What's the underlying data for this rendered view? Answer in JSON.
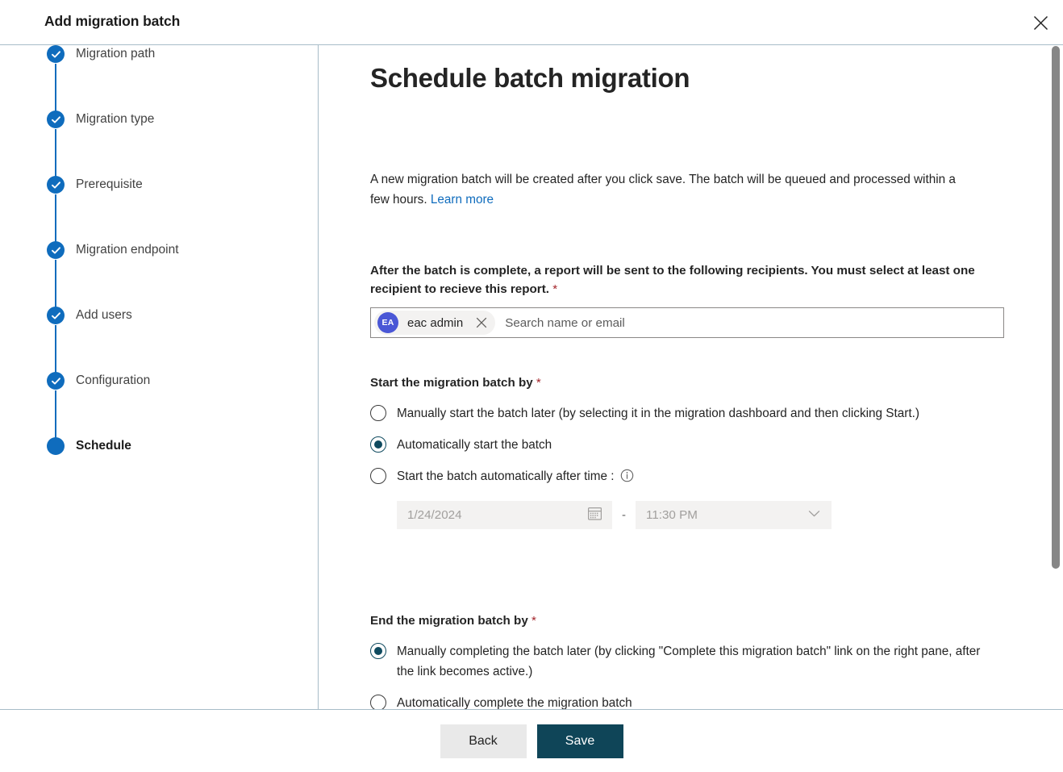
{
  "dialog": {
    "title": "Add migration batch",
    "close_icon": "close-icon"
  },
  "stepper": {
    "steps": [
      {
        "label": "Migration path",
        "state": "completed"
      },
      {
        "label": "Migration type",
        "state": "completed"
      },
      {
        "label": "Prerequisite",
        "state": "completed"
      },
      {
        "label": "Migration endpoint",
        "state": "completed"
      },
      {
        "label": "Add users",
        "state": "completed"
      },
      {
        "label": "Configuration",
        "state": "completed"
      },
      {
        "label": "Schedule",
        "state": "current"
      }
    ],
    "accent_color": "#0f6cbd"
  },
  "main": {
    "heading": "Schedule batch migration",
    "intro_text": "A new migration batch will be created after you click save. The batch will be queued and processed within a few hours. ",
    "intro_link": "Learn more",
    "recipients": {
      "label": "After the batch is complete, a report will be sent to the following recipients. You must select at least one recipient to recieve this report.",
      "required_marker": "*",
      "chip": {
        "initials": "EA",
        "name": "eac admin",
        "avatar_color": "#4a57d6",
        "remove_icon": "close-icon"
      },
      "placeholder": "Search name or email"
    },
    "start_group": {
      "label": "Start the migration batch by",
      "required_marker": "*",
      "options": [
        {
          "label": "Manually start the batch later (by selecting it in the migration dashboard and then clicking Start.)",
          "checked": false,
          "has_info_icon": false
        },
        {
          "label": "Automatically start the batch",
          "checked": true,
          "has_info_icon": false
        },
        {
          "label": "Start the batch automatically after time :",
          "checked": false,
          "has_info_icon": true
        }
      ],
      "date_value": "1/24/2024",
      "date_icon": "calendar-icon",
      "separator": "-",
      "time_value": "11:30 PM",
      "time_icon": "chevron-down-icon",
      "inputs_disabled": true
    },
    "end_group": {
      "label": "End the migration batch by",
      "required_marker": "*",
      "options": [
        {
          "label": "Manually completing the batch later (by clicking \"Complete this migration batch\" link on the right pane, after the link becomes active.)",
          "checked": true
        },
        {
          "label": "Automatically complete the migration batch",
          "checked": false
        }
      ]
    },
    "selected_radio_color": "#0f4a5f"
  },
  "footer": {
    "back_label": "Back",
    "save_label": "Save",
    "save_color": "#0f4558"
  }
}
